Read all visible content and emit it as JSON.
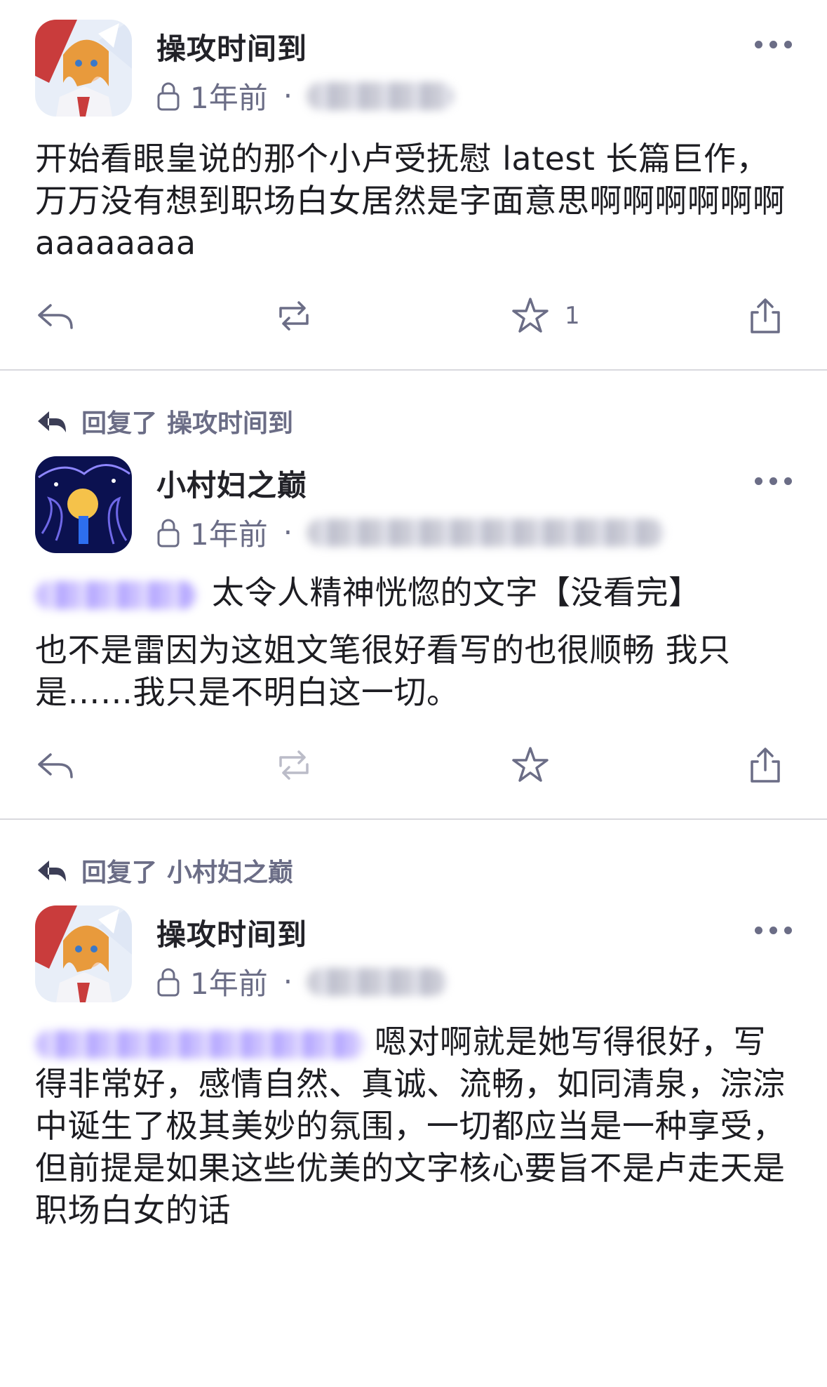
{
  "posts": [
    {
      "reply_prefix": "",
      "reply_to": "",
      "author": "操攻时间到",
      "time": "1年前",
      "content": "开始看眼皇说的那个小卢受抚慰 latest 长篇巨作，万万没有想到职场白女居然是字面意思啊啊啊啊啊啊 aaaaaaaa",
      "favorite_count": "1",
      "avatar_theme": "anime-girl-red-white"
    },
    {
      "reply_prefix": "回复了",
      "reply_to": "操攻时间到",
      "author": "小村妇之巅",
      "time": "1年前",
      "content_line1": "太令人精神恍惚的文字【没看完】",
      "content": "也不是雷因为这姐文笔很好看写的也很顺畅 我只是……我只是不明白这一切。",
      "favorite_count": "",
      "avatar_theme": "dark-blue-doodle"
    },
    {
      "reply_prefix": "回复了",
      "reply_to": "小村妇之巅",
      "author": "操攻时间到",
      "time": "1年前",
      "content": "嗯对啊就是她写得很好，写得非常好，感情自然、真诚、流畅，如同清泉，淙淙中诞生了极其美妙的氛围，一切都应当是一种享受，但前提是如果这些优美的文字核心要旨不是卢走天是职场白女的话",
      "favorite_count": "",
      "avatar_theme": "anime-girl-red-white"
    }
  ],
  "icons": [
    "more-icon",
    "lock-icon",
    "reply-icon",
    "repost-icon",
    "star-icon",
    "share-icon",
    "reply-arrow-icon"
  ],
  "colors": {
    "accent": "#6b6d86",
    "mention": "#9c8aff",
    "divider": "#d9d9de"
  }
}
